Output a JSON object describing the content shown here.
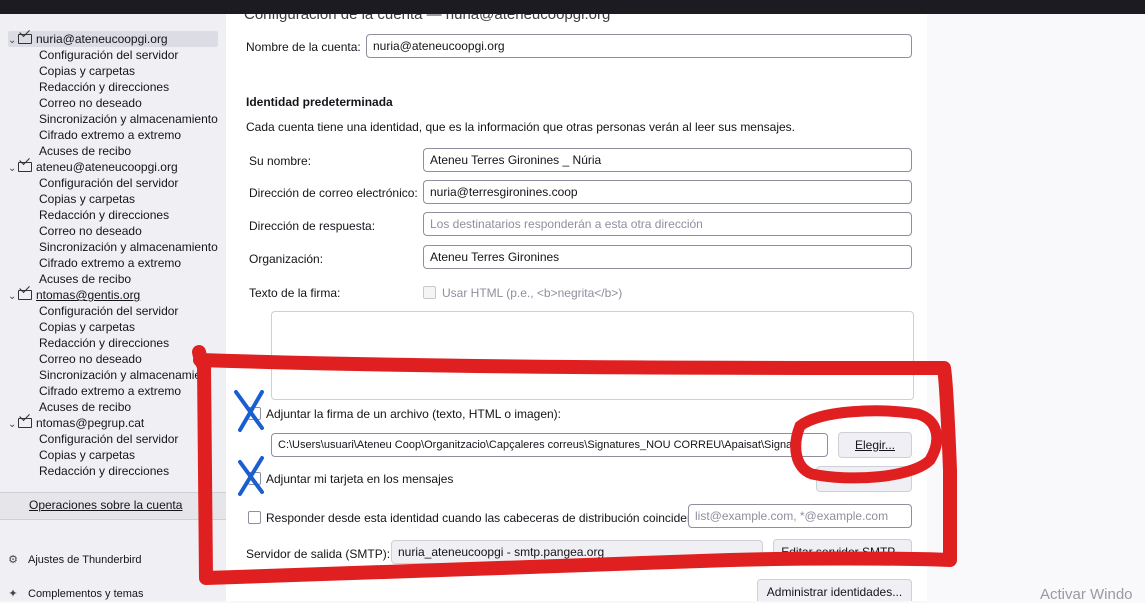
{
  "header": {
    "title": "Configuración de la cuenta — nuria@ateneucoopgi.org"
  },
  "sidebar": {
    "accounts": [
      {
        "name": "nuria@ateneucoopgi.org",
        "selected": true,
        "items": [
          "Configuración del servidor",
          "Copias y carpetas",
          "Redacción y direcciones",
          "Correo no deseado",
          "Sincronización y almacenamiento",
          "Cifrado extremo a extremo",
          "Acuses de recibo"
        ]
      },
      {
        "name": "ateneu@ateneucoopgi.org",
        "items": [
          "Configuración del servidor",
          "Copias y carpetas",
          "Redacción y direcciones",
          "Correo no deseado",
          "Sincronización y almacenamiento",
          "Cifrado extremo a extremo",
          "Acuses de recibo"
        ]
      },
      {
        "name": "ntomas@gentis.org",
        "items": [
          "Configuración del servidor",
          "Copias y carpetas",
          "Redacción y direcciones",
          "Correo no deseado",
          "Sincronización y almacenamie",
          "Cifrado extremo a extremo",
          "Acuses de recibo"
        ]
      },
      {
        "name": "ntomas@pegrup.cat",
        "items": [
          "Configuración del servidor",
          "Copias y carpetas",
          "Redacción y direcciones"
        ]
      }
    ],
    "operations_label": "Operaciones sobre la cuenta",
    "footer": [
      {
        "label": "Ajustes de Thunderbird",
        "icon": "gear-icon"
      },
      {
        "label": "Complementos y temas",
        "icon": "puzzle-icon"
      }
    ]
  },
  "form": {
    "account_name_label": "Nombre de la cuenta:",
    "account_name_value": "nuria@ateneucoopgi.org",
    "identity_heading": "Identidad predeterminada",
    "identity_desc": "Cada cuenta tiene una identidad, que es la información que otras personas verán al leer sus mensajes.",
    "your_name_label": "Su nombre:",
    "your_name_value": "Ateneu Terres Gironines _ Núria",
    "email_label": "Dirección de correo electrónico:",
    "email_value": "nuria@terresgironines.coop",
    "reply_label": "Dirección de respuesta:",
    "reply_placeholder": "Los destinatarios responderán a esta otra dirección",
    "org_label": "Organización:",
    "org_value": "Ateneu Terres Gironines",
    "sig_label": "Texto de la firma:",
    "use_html_label": "Usar HTML (p.e., <b>negrita</b>)",
    "attach_sig_label": "Adjuntar la firma de un archivo (texto, HTML o imagen):",
    "sig_file_path": "C:\\Users\\usuari\\Ateneu Coop\\Organitzacio\\Capçaleres correus\\Signatures_NOU CORREU\\Apaisat\\Signat",
    "choose_button": "Elegir...",
    "attach_vcard_label": "Adjuntar mi tarjeta en los mensajes",
    "reply_identity_label": "Responder desde esta identidad cuando las cabeceras de distribución coinciden:",
    "reply_identity_placeholder": "list@example.com, *@example.com",
    "smtp_label": "Servidor de salida (SMTP):",
    "smtp_value": "nuria_ateneucoopgi - smtp.pangea.org",
    "edit_smtp_button": "Editar servidor SMTP...",
    "manage_identities_button": "Administrar identidades..."
  },
  "watermark": "Activar Windo",
  "annotation_color": "#e02020",
  "x_mark_color": "#1a5fd0"
}
